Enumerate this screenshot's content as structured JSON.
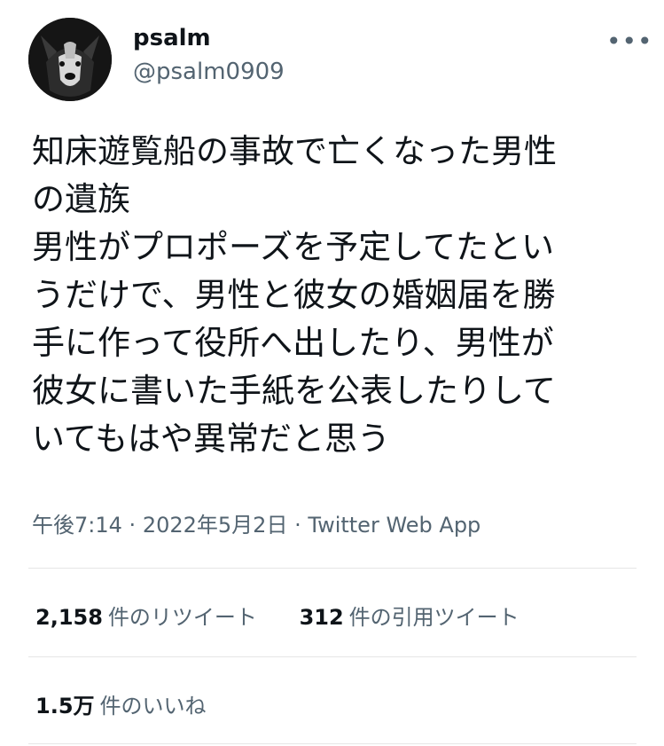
{
  "user": {
    "display_name": "psalm",
    "handle": "@psalm0909",
    "more_icon": "more-horizontal-icon"
  },
  "tweet": {
    "lines": [
      "知床遊覧船の事故で亡くなった男性",
      "の遺族",
      "男性がプロポーズを予定してたとい",
      "うだけで、男性と彼女の婚姻届を勝",
      "手に作って役所へ出したり、男性が",
      "彼女に書いた手紙を公表したりして",
      "いてもはや異常だと思う"
    ]
  },
  "meta": {
    "time": "午後7:14",
    "separator": "·",
    "date": "2022年5月2日",
    "source": "Twitter Web App"
  },
  "stats": {
    "retweets_count": "2,158",
    "retweets_label": "件のリツイート",
    "quotes_count": "312",
    "quotes_label": "件の引用ツイート",
    "likes_count": "1.5万",
    "likes_label": "件のいいね"
  }
}
